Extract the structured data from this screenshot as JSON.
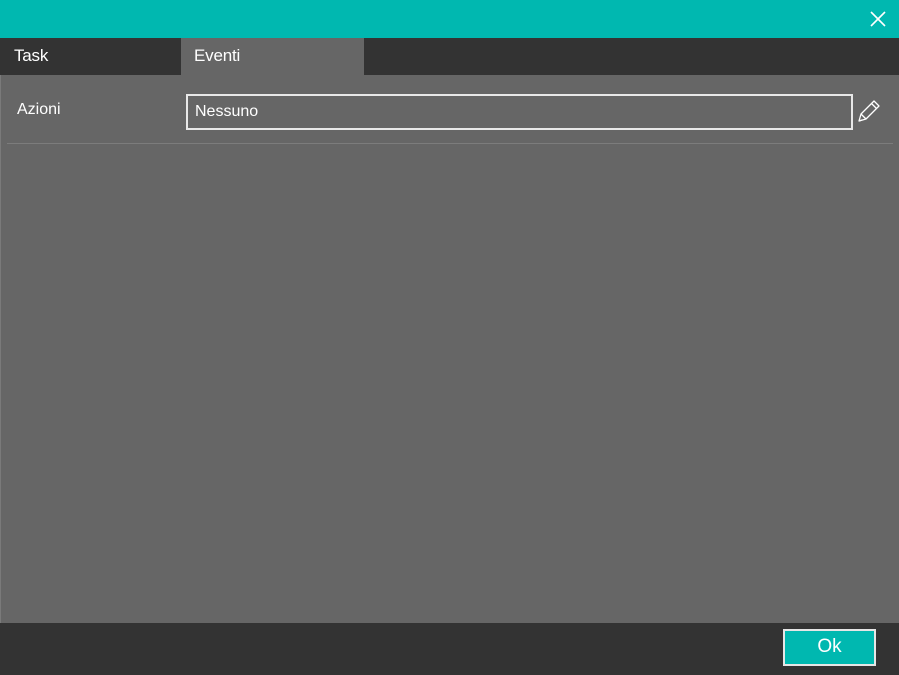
{
  "colors": {
    "accent": "#00b8b0",
    "panel": "#666666",
    "dark": "#333333",
    "text": "#ffffff"
  },
  "titlebar": {
    "close_icon": "close-icon"
  },
  "tabs": [
    {
      "label": "Task",
      "active": false
    },
    {
      "label": "Eventi",
      "active": true
    }
  ],
  "form": {
    "rows": [
      {
        "label": "Azioni",
        "value": "Nessuno",
        "edit_icon": "pencil-icon"
      }
    ]
  },
  "footer": {
    "ok_label": "Ok"
  }
}
